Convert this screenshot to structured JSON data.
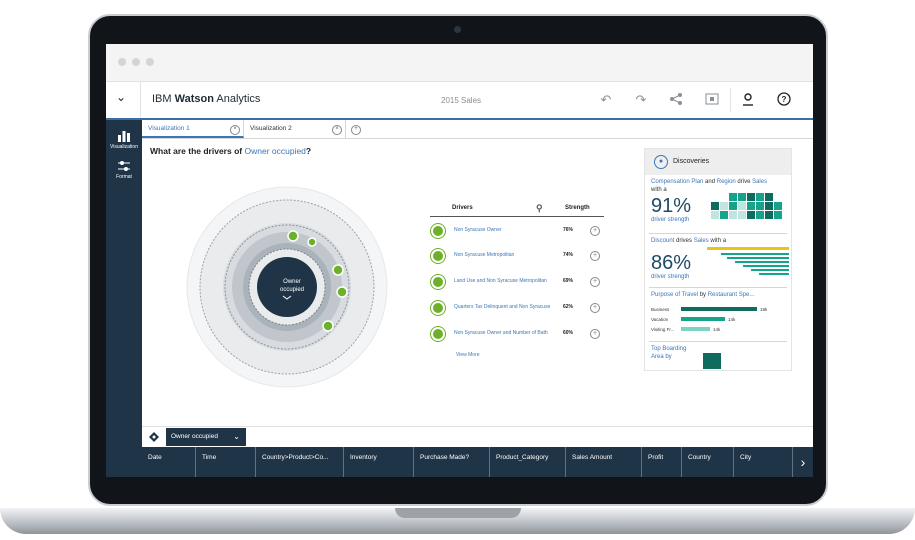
{
  "app": {
    "brand_prefix": "IBM",
    "brand_main": "Watson",
    "brand_suffix": "Analytics",
    "dataset": "2015 Sales"
  },
  "tabs": [
    {
      "label": "Visualization 1"
    },
    {
      "label": "Visualization 2"
    }
  ],
  "sidebar": {
    "visualization": "Visualization",
    "format": "Format"
  },
  "question": {
    "prefix": "What are the drivers of",
    "target": "Owner occupied",
    "suffix": "?"
  },
  "center_label": {
    "line1": "Owner",
    "line2": "occupied"
  },
  "drivers": {
    "col_drivers": "Drivers",
    "col_strength": "Strength",
    "rows": [
      {
        "label": "Non Syracuse Owner",
        "strength": "76%"
      },
      {
        "label": "Non Syracuse Metropolitan",
        "strength": "74%"
      },
      {
        "label": "Land Use and Non Syracuse Metropolitan",
        "strength": "69%"
      },
      {
        "label": "Quarters Tax Delinquent and Non Syracuse",
        "strength": "62%"
      },
      {
        "label": "Non Syracuse Owner and Number of Bath",
        "strength": "60%"
      }
    ],
    "view_more": "View More"
  },
  "discoveries": {
    "title": "Discoveries",
    "card1": {
      "part1": "Compensation Plan",
      "part2": " and ",
      "part3": "Region",
      "part4": " drive ",
      "part5": "Sales",
      "part6": "with a",
      "pct": "91%",
      "caption": "driver strength"
    },
    "card2": {
      "part1": "Discount",
      "part2": " drives ",
      "part3": "Sales",
      "part4": " with a",
      "pct": "86%",
      "caption": "driver strength"
    },
    "card3": {
      "part1": "Purpose of Travel",
      "part2": " by ",
      "part3": "Restaurant Spe...",
      "bars": [
        {
          "label": "Business",
          "value": "19k"
        },
        {
          "label": "Vacation",
          "value": "14k"
        },
        {
          "label": "Visiting Fr...",
          "value": "14k"
        }
      ]
    },
    "card4": {
      "line1": "Top Boarding",
      "line2": "Area by"
    }
  },
  "filter": {
    "label": "Owner occupied"
  },
  "columns": [
    "Date",
    "Time",
    "Country>Product>Co...",
    "Inventory",
    "Purchase Made?",
    "Product_Category",
    "Sales Amount",
    "Profit",
    "Country",
    "City"
  ],
  "colors": {
    "navy": "#1f3447",
    "accent_blue": "#3a77b8",
    "green": "#6fb02a",
    "teal": "#15a38c",
    "yellow": "#e9c21a"
  }
}
